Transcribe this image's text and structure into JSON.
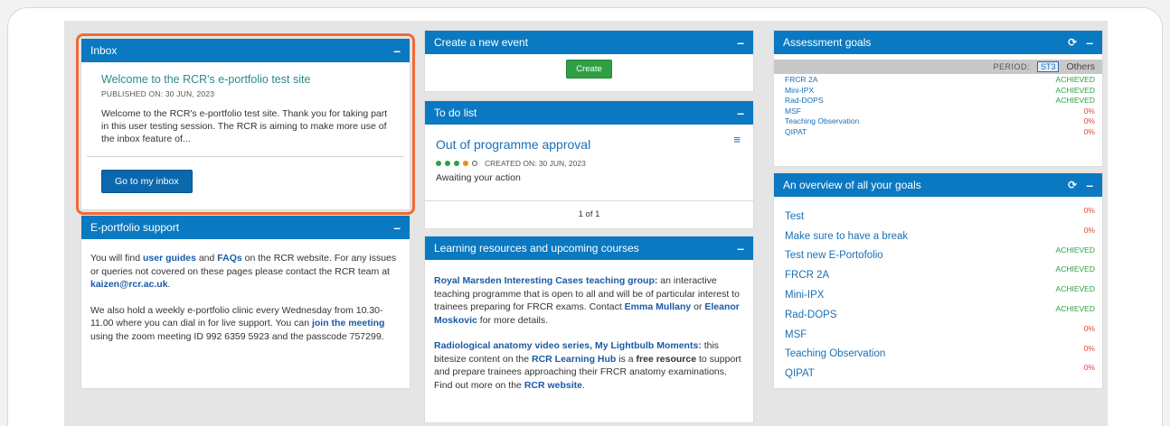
{
  "inbox": {
    "header": "Inbox",
    "collapse": "–",
    "message_title": "Welcome to the RCR's e-portfolio test site",
    "published": "PUBLISHED ON: 30 JUN, 2023",
    "message_text": "Welcome to the RCR's e-portfolio test site. Thank you for taking part in this user testing session. The RCR is aiming to make more use of the inbox feature of...",
    "button": "Go to my inbox"
  },
  "support": {
    "header": "E-portfolio support",
    "collapse": "–",
    "p1_a": "You will find ",
    "p1_link1": "user guides",
    "p1_b": " and ",
    "p1_link2": "FAQs",
    "p1_c": " on the RCR website. For any issues or queries not covered on these pages please contact the RCR team at ",
    "p1_email": "kaizen@rcr.ac.uk",
    "p1_d": ".",
    "p2_a": "We also hold a weekly e-portfolio clinic every Wednesday from 10.30-11.00 where you can dial in for live support. You can ",
    "p2_link": "join the meeting",
    "p2_b": " using the zoom meeting ID 992 6359 5923 and the passcode 757299."
  },
  "create_event": {
    "header": "Create a new event",
    "collapse": "–",
    "button": "Create"
  },
  "todo": {
    "header": "To do list",
    "collapse": "–",
    "item_title": "Out of programme approval",
    "created": "CREATED ON: 30 JUN, 2023",
    "status": "Awaiting your action",
    "pagination": "1 of 1"
  },
  "learning": {
    "header": "Learning resources and upcoming courses",
    "collapse": "–",
    "p1_title": "Royal Marsden Interesting Cases teaching group:",
    "p1_a": " an interactive teaching programme that is open to all and will be of particular interest to trainees preparing for FRCR exams. Contact ",
    "p1_link1": "Emma Mullany",
    "p1_b": " or ",
    "p1_link2": "Eleanor Moskovic",
    "p1_c": " for more details.",
    "p2_title": "Radiological anatomy video series, My Lightbulb Moments:",
    "p2_a": " this bitesize content on the ",
    "p2_link1": "RCR Learning Hub",
    "p2_b": " is a ",
    "p2_bold": "free resource",
    "p2_c": " to support and prepare trainees approaching their FRCR anatomy examinations. Find out more on the ",
    "p2_link2": "RCR website",
    "p2_d": "."
  },
  "assessment": {
    "header": "Assessment goals",
    "collapse": "–",
    "period_label": "PERIOD:",
    "period_selected": "ST3",
    "period_other": "Others",
    "goals": [
      {
        "name": "FRCR 2A",
        "status": "ACHIEVED"
      },
      {
        "name": "Mini-IPX",
        "status": "ACHIEVED"
      },
      {
        "name": "Rad-DOPS",
        "status": "ACHIEVED"
      },
      {
        "name": "MSF",
        "status": "0%"
      },
      {
        "name": "Teaching Observation",
        "status": "0%"
      },
      {
        "name": "QIPAT",
        "status": "0%"
      }
    ]
  },
  "overview": {
    "header": "An overview of all your goals",
    "collapse": "–",
    "goals": [
      {
        "name": "Test",
        "status": "0%"
      },
      {
        "name": "Make sure to have a break",
        "status": "0%"
      },
      {
        "name": "Test new E-Portofolio",
        "status": "ACHIEVED"
      },
      {
        "name": "FRCR 2A",
        "status": "ACHIEVED"
      },
      {
        "name": "Mini-IPX",
        "status": "ACHIEVED"
      },
      {
        "name": "Rad-DOPS",
        "status": "ACHIEVED"
      },
      {
        "name": "MSF",
        "status": "0%"
      },
      {
        "name": "Teaching Observation",
        "status": "0%"
      },
      {
        "name": "QIPAT",
        "status": "0%"
      }
    ]
  },
  "colors": {
    "header_blue": "#0b79c1",
    "highlight_orange": "#f06a35",
    "achieved_green": "#2ea043",
    "pending_red": "#e0453a"
  },
  "icons": {
    "refresh": "refresh-icon",
    "list": "list-icon",
    "collapse": "minus-icon"
  }
}
